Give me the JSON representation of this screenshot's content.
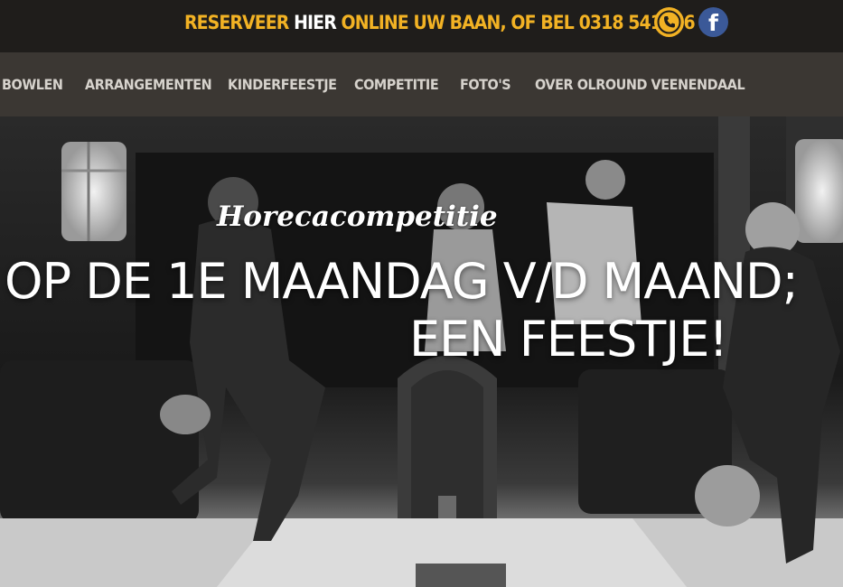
{
  "topbar": {
    "text_before": "RESERVEER",
    "text_highlight": "HIER",
    "text_after": "ONLINE UW BAAN, OF BEL 0318 541196",
    "colors": {
      "accent": "#f2b224",
      "background": "#1f1d1b",
      "highlight": "#ffffff"
    },
    "icons": [
      "phone-icon",
      "facebook-icon"
    ]
  },
  "nav": {
    "items": [
      {
        "label": "BOWLEN"
      },
      {
        "label": "ARRANGEMENTEN"
      },
      {
        "label": "KINDERFEESTJE"
      },
      {
        "label": "COMPETITIE"
      },
      {
        "label": "FOTO'S"
      },
      {
        "label": "OVER OLROUND VEENENDAAL"
      }
    ],
    "colors": {
      "background": "#3b3733",
      "text": "#d6d2cc"
    }
  },
  "hero": {
    "kicker": "Horecacompetitie",
    "headline_line1": "OP DE 1E MAANDAG V/D MAAND;",
    "headline_line2": "EEN FEESTJE!"
  }
}
